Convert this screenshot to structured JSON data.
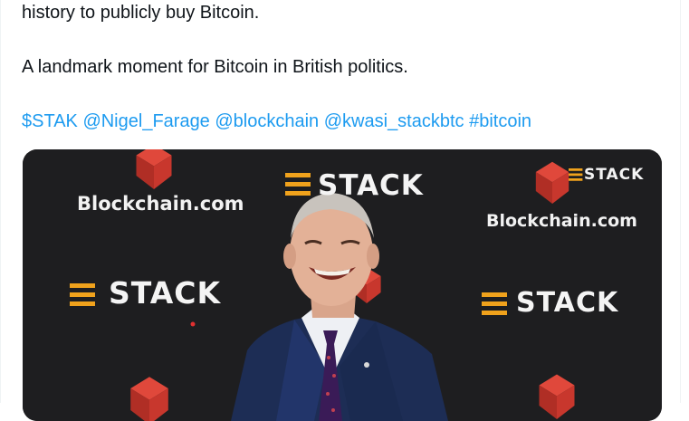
{
  "tweet": {
    "line1": "history to publicly buy Bitcoin.",
    "line2": "A landmark moment for Bitcoin in British politics.",
    "tags": [
      "$STAK",
      "@Nigel_Farage",
      "@blockchain",
      "@kwasi_stackbtc",
      "#bitcoin"
    ]
  },
  "media": {
    "backdrop_brand_1": "Blockchain.com",
    "backdrop_brand_2": "STACK",
    "colors": {
      "backdrop": "#1e1e20",
      "blockchain_red": "#c8372d",
      "stack_orange": "#f0a21c",
      "suit": "#1d2d55"
    }
  },
  "colors": {
    "text": "#0f1419",
    "link": "#1d9bf0"
  }
}
